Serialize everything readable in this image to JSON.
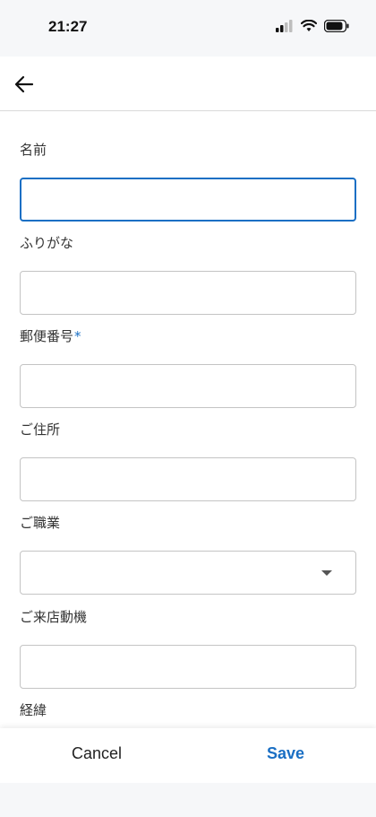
{
  "status_bar": {
    "time": "21:27"
  },
  "header": {
    "back_icon": "arrow-left-icon"
  },
  "form": {
    "fields": [
      {
        "label": "名前",
        "value": "",
        "required": false
      },
      {
        "label": "ふりがな",
        "value": "",
        "required": false
      },
      {
        "label": "郵便番号",
        "value": "",
        "required": true,
        "required_mark": "*"
      },
      {
        "label": "ご住所",
        "value": "",
        "required": false
      },
      {
        "label": "ご職業",
        "value": "",
        "required": false,
        "type": "select"
      },
      {
        "label": "ご来店動機",
        "value": "",
        "required": false
      },
      {
        "label": "経緯",
        "value": "",
        "required": false
      }
    ]
  },
  "actions": {
    "cancel_label": "Cancel",
    "save_label": "Save"
  },
  "colors": {
    "accent": "#1a6fc4",
    "focus_border": "#1a6fc4",
    "status_bg": "#f6f7f9"
  }
}
